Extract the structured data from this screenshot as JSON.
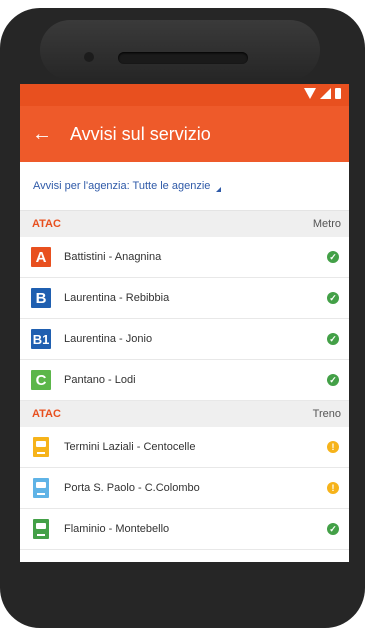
{
  "colors": {
    "accent": "#ee5a2a",
    "status_bar": "#e8501f",
    "link": "#2f5aa8",
    "ok": "#43a047",
    "warn": "#f6b31a"
  },
  "app_bar": {
    "back_icon": "←",
    "title": "Avvisi sul servizio"
  },
  "filter": {
    "label": "Avvisi per l'agenzia: Tutte le agenzie"
  },
  "sections": [
    {
      "agency": "ATAC",
      "mode": "Metro",
      "items": [
        {
          "badge": "A",
          "badge_color": "#e8501f",
          "label": "Battistini - Anagnina",
          "status": "ok",
          "status_icon": "✓"
        },
        {
          "badge": "B",
          "badge_color": "#1f5fb0",
          "label": "Laurentina - Rebibbia",
          "status": "ok",
          "status_icon": "✓"
        },
        {
          "badge": "B1",
          "badge_color": "#1f5fb0",
          "label": "Laurentina - Jonio",
          "status": "ok",
          "status_icon": "✓"
        },
        {
          "badge": "C",
          "badge_color": "#5cb64a",
          "label": "Pantano - Lodi",
          "status": "ok",
          "status_icon": "✓"
        }
      ]
    },
    {
      "agency": "ATAC",
      "mode": "Treno",
      "items": [
        {
          "icon": "train-icon",
          "icon_color": "#f6b31a",
          "label": "Termini Laziali - Centocelle",
          "status": "warn",
          "status_icon": "!"
        },
        {
          "icon": "train-icon",
          "icon_color": "#5fb3e6",
          "label": "Porta S. Paolo - C.Colombo",
          "status": "warn",
          "status_icon": "!"
        },
        {
          "icon": "train-icon",
          "icon_color": "#43a047",
          "label": "Flaminio - Montebello",
          "status": "ok",
          "status_icon": "✓"
        }
      ]
    }
  ]
}
